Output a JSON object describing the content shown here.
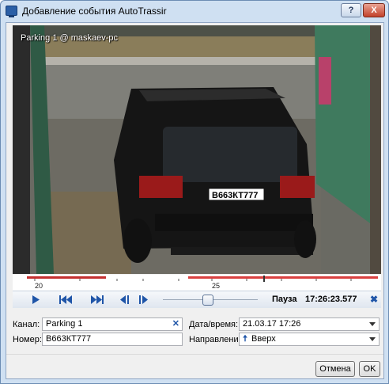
{
  "window": {
    "title": "Добавление события AutoTrassir",
    "help_label": "?",
    "close_label": "X"
  },
  "video": {
    "overlay_text": "Parking 1 @ maskaev-pc",
    "plate_text": "В663КТ777"
  },
  "timeline": {
    "tick_labels": [
      "20",
      "25"
    ]
  },
  "controls": {
    "state_text": "Пауза",
    "time_text": "17:26:23.577",
    "icons": [
      "play-icon",
      "skip-to-start-icon",
      "skip-to-end-icon",
      "step-back-icon",
      "step-forward-icon",
      "close-icon"
    ],
    "accent_color": "#1f55a8"
  },
  "form": {
    "channel_label": "Канал:",
    "channel_value": "Parking 1",
    "number_label": "Номер:",
    "number_value": "В663КТ777",
    "datetime_label": "Дата/время:",
    "datetime_value": "21.03.17 17:26",
    "direction_label": "Направление:",
    "direction_value": "Вверх"
  },
  "buttons": {
    "cancel_label": "Отмена",
    "ok_label": "OK"
  }
}
